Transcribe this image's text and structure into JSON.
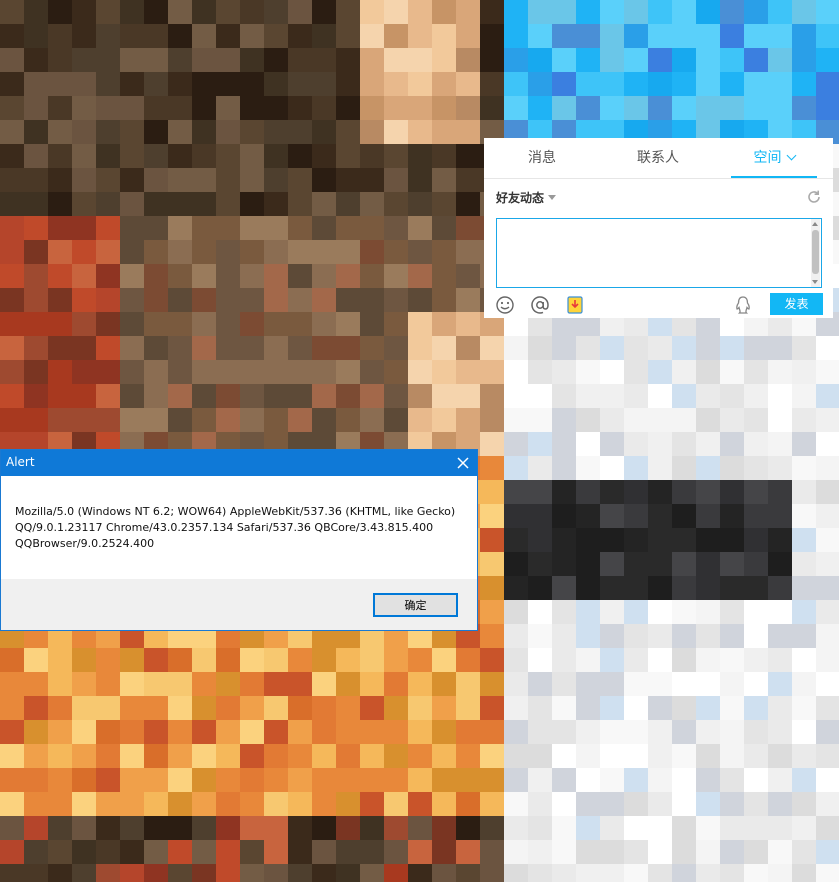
{
  "qq_panel": {
    "tabs": [
      {
        "label": "消息",
        "active": false
      },
      {
        "label": "联系人",
        "active": false
      },
      {
        "label": "空间",
        "active": true
      }
    ],
    "feed": {
      "label": "好友动态",
      "post_text": "",
      "send_label": "发表"
    },
    "toolbar_icons": [
      "emoji-icon",
      "mention-icon",
      "image-icon",
      "qq-penguin-icon"
    ],
    "accent_color": "#12b7f5"
  },
  "alert": {
    "title": "Alert",
    "message": "Mozilla/5.0 (Windows NT 6.2; WOW64) AppleWebKit/537.36 (KHTML, like Gecko)\nQQ/9.0.1.23117 Chrome/43.0.2357.134 Safari/537.36 QBCore/3.43.815.400\nQQBrowser/9.0.2524.400",
    "ok_label": "确定",
    "title_color": "#0f79d7"
  }
}
